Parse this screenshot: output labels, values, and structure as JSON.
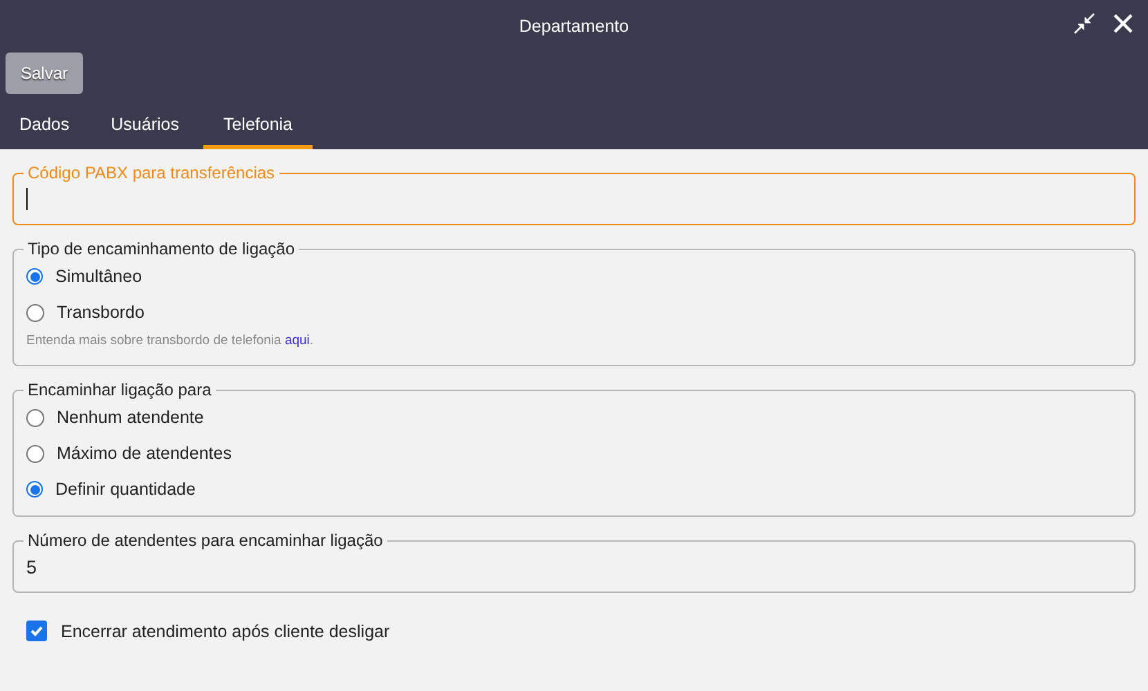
{
  "window": {
    "title": "Departamento"
  },
  "toolbar": {
    "save_button": {
      "label": "Salvar",
      "disabled": true
    }
  },
  "tabs": [
    {
      "label": "Dados",
      "selected": false
    },
    {
      "label": "Usuários",
      "selected": false
    },
    {
      "label": "Telefonia",
      "selected": true
    }
  ],
  "sections": [
    {
      "kind": "text_field",
      "label": "Código PABX para transferências",
      "focused": true
    },
    {
      "kind": "radio_group",
      "label": "Tipo de encaminhamento de ligação",
      "options": [
        {
          "label": "Simultâneo",
          "selected": true
        },
        {
          "label": "Transbordo",
          "selected": false
        }
      ],
      "help": {
        "text": "Entenda mais sobre transbordo de telefonia ",
        "link": "aqui",
        "after": "."
      }
    },
    {
      "kind": "radio_group",
      "label": "Encaminhar ligação para",
      "options": [
        {
          "label": "Nenhum atendente",
          "selected": false
        },
        {
          "label": "Máximo de atendentes",
          "selected": false
        },
        {
          "label": "Definir quantidade",
          "selected": true
        }
      ]
    },
    {
      "kind": "text_field",
      "label": "Número de atendentes para encaminhar ligação",
      "value": "5",
      "focused": false
    },
    {
      "kind": "checkbox",
      "label": "Encerrar atendimento após cliente desligar",
      "checked": true
    }
  ]
}
